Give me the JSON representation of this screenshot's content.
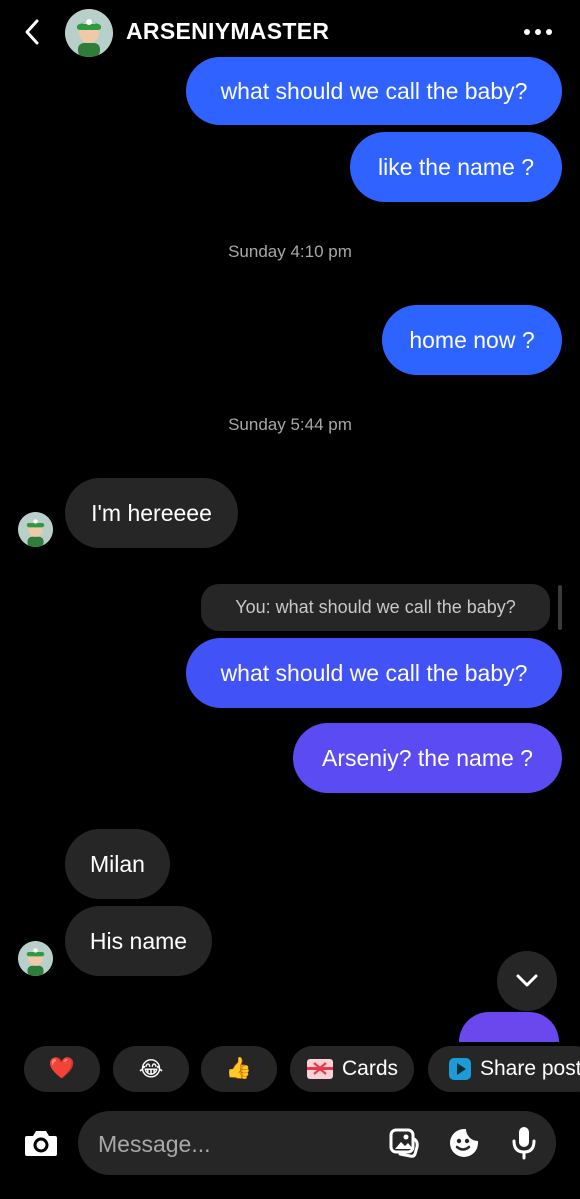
{
  "header": {
    "title": "ARSENIYMASTER"
  },
  "messages": {
    "m1": "what should we call the baby?",
    "m2": "like the name ?",
    "t1": "Sunday 4:10 pm",
    "m3": "home now ?",
    "t2": "Sunday 5:44 pm",
    "m4": "I'm hereeee",
    "quote": "You: what should we call the baby?",
    "m5": "what should we call the baby?",
    "m6": "Arseniy? the name ?",
    "m7": "Milan",
    "m8": "His name"
  },
  "quick_replies": {
    "heart": "❤️",
    "laugh": "😂",
    "thumbs": "👍",
    "cards": "Cards",
    "share": "Share post"
  },
  "composer": {
    "placeholder": "Message..."
  },
  "colors": {
    "bubble_blue": "#2d63ff",
    "bubble_indigo": "#4b53f5",
    "bubble_purple": "#6b48ee",
    "incoming": "#262626"
  }
}
